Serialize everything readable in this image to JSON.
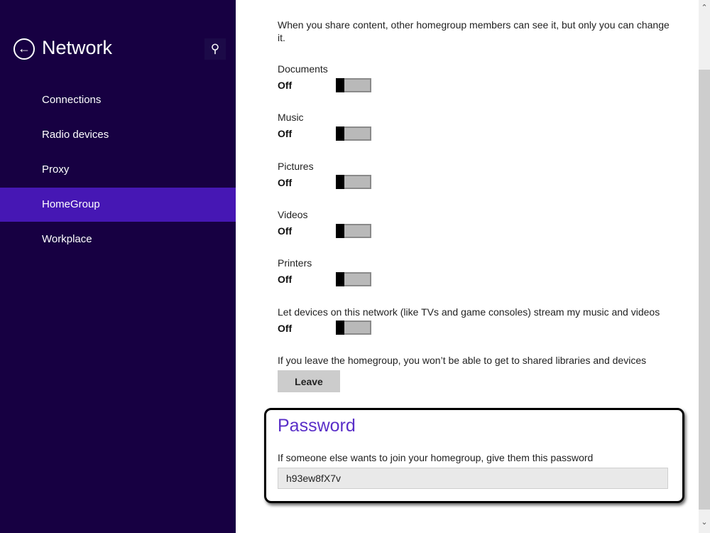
{
  "sidebar": {
    "title": "Network",
    "back_icon": "back-arrow-icon",
    "search_icon": "search-icon",
    "items": [
      {
        "label": "Connections"
      },
      {
        "label": "Radio devices"
      },
      {
        "label": "Proxy"
      },
      {
        "label": "HomeGroup",
        "selected": true
      },
      {
        "label": "Workplace"
      }
    ]
  },
  "main": {
    "intro": "When you share content, other homegroup members can see it, but only you can change it.",
    "toggles": [
      {
        "label": "Documents",
        "state": "Off"
      },
      {
        "label": "Music",
        "state": "Off"
      },
      {
        "label": "Pictures",
        "state": "Off"
      },
      {
        "label": "Videos",
        "state": "Off"
      },
      {
        "label": "Printers",
        "state": "Off"
      },
      {
        "label": "Let devices on this network (like TVs and game consoles) stream my music and videos",
        "state": "Off"
      }
    ],
    "leave_text": "If you leave the homegroup, you won’t be able to get to shared libraries and devices",
    "leave_button": "Leave",
    "password": {
      "heading": "Password",
      "description": "If someone else wants to join your homegroup, give them this password",
      "value": "h93ew8fX7v"
    }
  },
  "colors": {
    "sidebar": "#170042",
    "selected": "#4617b4",
    "accent": "#5a2fc8"
  }
}
